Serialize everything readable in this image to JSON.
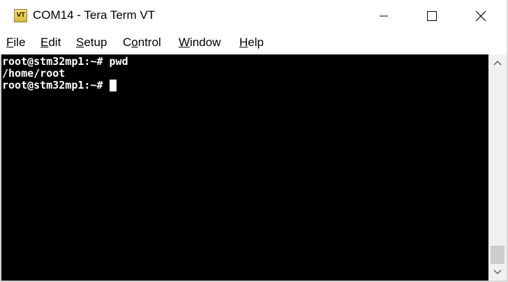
{
  "window": {
    "title": "COM14 - Tera Term VT",
    "icon_label": "VT",
    "icon_name": "tera-term-vt-icon"
  },
  "caption_buttons": {
    "minimize_icon": "minimize-icon",
    "maximize_icon": "maximize-icon",
    "close_icon": "close-icon"
  },
  "menu": {
    "items": [
      {
        "mnemonic": "F",
        "rest": "ile"
      },
      {
        "mnemonic": "E",
        "rest": "dit"
      },
      {
        "mnemonic": "S",
        "rest": "etup"
      },
      {
        "pre": "C",
        "mnemonic": "o",
        "rest": "ntrol"
      },
      {
        "mnemonic": "W",
        "rest": "indow"
      },
      {
        "mnemonic": "H",
        "rest": "elp"
      }
    ]
  },
  "terminal": {
    "lines": [
      "root@stm32mp1:~# pwd",
      "/home/root",
      "root@stm32mp1:~# "
    ],
    "background": "#000000",
    "foreground": "#ffffff"
  },
  "scrollbar": {
    "up_icon": "scroll-up-arrow-icon",
    "down_icon": "scroll-down-arrow-icon"
  }
}
